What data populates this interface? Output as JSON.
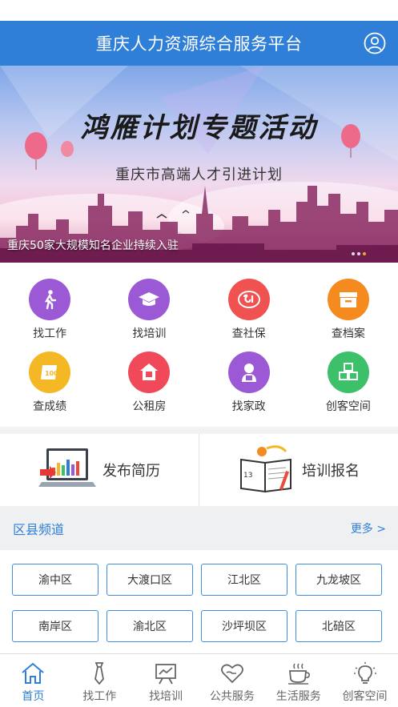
{
  "header": {
    "title": "重庆人力资源综合服务平台",
    "user_icon": "user-icon"
  },
  "banner": {
    "headline": "鸿雁计划专题活动",
    "subline": "重庆市高端人才引进计划",
    "caption": "重庆50家大规模知名企业持续入驻",
    "dots": 3,
    "active_dot": 2
  },
  "services": [
    {
      "label": "找工作",
      "icon": "walking-person-icon",
      "color": "#9b59d6"
    },
    {
      "label": "找培训",
      "icon": "graduation-cap-icon",
      "color": "#9b59d6"
    },
    {
      "label": "查社保",
      "icon": "social-security-icon",
      "color": "#f05252"
    },
    {
      "label": "查档案",
      "icon": "archive-box-icon",
      "color": "#f58a1f"
    },
    {
      "label": "查成绩",
      "icon": "score-sheet-icon",
      "color": "#f5b825"
    },
    {
      "label": "公租房",
      "icon": "rental-house-icon",
      "color": "#f04a5a"
    },
    {
      "label": "找家政",
      "icon": "housekeeper-icon",
      "color": "#9b59d6"
    },
    {
      "label": "创客空间",
      "icon": "cubes-icon",
      "color": "#3cc16a"
    }
  ],
  "promo": {
    "resume_label": "发布简历",
    "training_label": "培训报名"
  },
  "districts": {
    "title": "区县频道",
    "more": "更多 >",
    "items": [
      "渝中区",
      "大渡口区",
      "江北区",
      "九龙坡区",
      "南岸区",
      "渝北区",
      "沙坪坝区",
      "北碚区"
    ]
  },
  "tabs": [
    {
      "label": "首页",
      "icon": "home-icon",
      "active": true
    },
    {
      "label": "找工作",
      "icon": "tie-icon",
      "active": false
    },
    {
      "label": "找培训",
      "icon": "chart-board-icon",
      "active": false
    },
    {
      "label": "公共服务",
      "icon": "heart-hand-icon",
      "active": false
    },
    {
      "label": "生活服务",
      "icon": "coffee-cup-icon",
      "active": false
    },
    {
      "label": "创客空间",
      "icon": "lightbulb-icon",
      "active": false
    }
  ],
  "colors": {
    "primary": "#2f7fd8",
    "page_bg": "#f2f2f2"
  }
}
